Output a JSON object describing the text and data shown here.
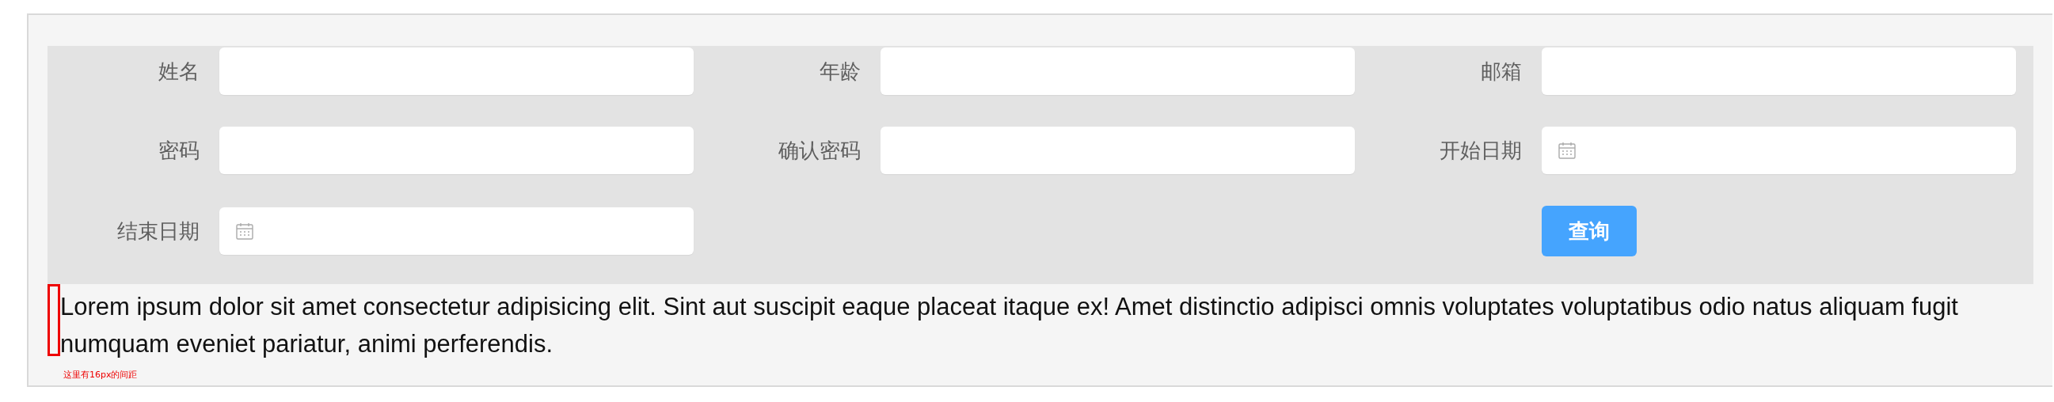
{
  "form": {
    "fields": [
      {
        "label": "姓名",
        "kind": "text"
      },
      {
        "label": "年龄",
        "kind": "text"
      },
      {
        "label": "邮箱",
        "kind": "text"
      },
      {
        "label": "密码",
        "kind": "text"
      },
      {
        "label": "确认密码",
        "kind": "text"
      },
      {
        "label": "开始日期",
        "kind": "date"
      },
      {
        "label": "结束日期",
        "kind": "date"
      }
    ],
    "button": "查询"
  },
  "paragraph": "Lorem ipsum dolor sit amet consectetur adipisicing elit. Sint aut suscipit eaque placeat itaque ex! Amet distinctio adipisci omnis voluptates voluptatibus odio natus aliquam fugit numquam eveniet pariatur, animi perferendis.",
  "annotation": "这里有16px的间距"
}
